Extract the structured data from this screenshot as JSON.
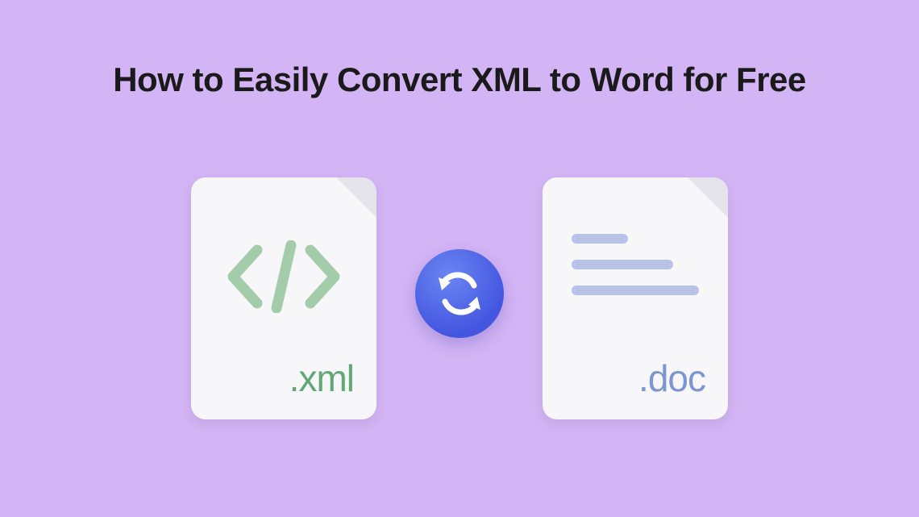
{
  "title": "How to Easily Convert XML to Word for Free",
  "left_file": {
    "extension": ".xml",
    "icon": "code-brackets-icon",
    "color": "#62a778"
  },
  "right_file": {
    "extension": ".doc",
    "icon": "document-lines-icon",
    "color": "#7b96d1"
  },
  "center": {
    "icon": "sync-arrows-icon",
    "bg_color": "#4456e0"
  }
}
